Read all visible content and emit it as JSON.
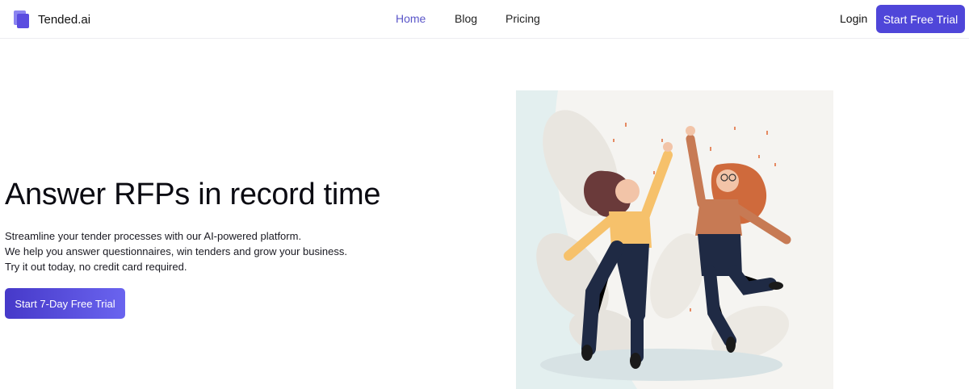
{
  "nav": {
    "brand": "Tended.ai",
    "links": [
      "Home",
      "Blog",
      "Pricing"
    ],
    "active": "Home",
    "login": "Login",
    "cta": "Start Free Trial"
  },
  "hero": {
    "title": "Answer RFPs in record time",
    "lines": [
      "Streamline your tender processes with our AI-powered platform.",
      "We help you answer questionnaires, win tenders and grow your business.",
      "Try it out today, no credit card required."
    ],
    "cta": "Start 7-Day Free Trial"
  },
  "colors": {
    "accent": "#4f46d9",
    "active_link": "#5b57c9",
    "logo_light": "#8b84f0",
    "logo_dark": "#5b4de0"
  },
  "icons": {
    "brand": "logo-icon",
    "illustration": "two-women-jumping-celebration"
  }
}
